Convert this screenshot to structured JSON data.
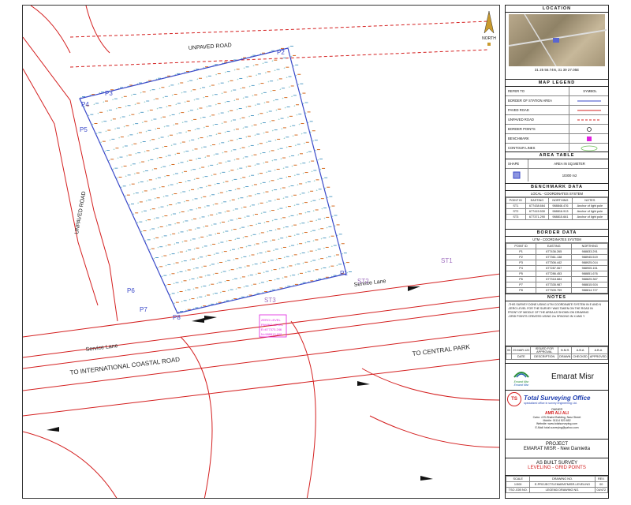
{
  "north_label": "NORTH",
  "location": {
    "title": "LOCATION",
    "coords": "31 25 56.74N, 31 39 27.05E"
  },
  "map_legend": {
    "title": "MAP LEGEND",
    "col_refer": "REFER TO",
    "col_symbol": "SYMBOL",
    "items": [
      {
        "label": "BORDER OF STATION AREA",
        "color": "#3a49c9"
      },
      {
        "label": "PAVED ROAD",
        "color": "#d42020"
      },
      {
        "label": "UNPAVED ROAD",
        "color": "#d42020"
      },
      {
        "label": "BORDER POINTS",
        "color": "#222222"
      },
      {
        "label": "BENCHMARK",
        "color": "#e020e0"
      },
      {
        "label": "CONTOUR LINES",
        "color": "#6fbf5a"
      }
    ]
  },
  "area_table": {
    "title": "AREA TABLE",
    "col_shape": "SHAPE",
    "col_area": "AREA IN SQ.METER",
    "value": "10300 m2"
  },
  "benchmark": {
    "title": "BENCHMARK DATA",
    "system": "LOCAL - COORDINATES SYSTEM",
    "headers": [
      "POINT ID",
      "EASTING",
      "NORTHING",
      "NOTES"
    ],
    "rows": [
      [
        "ST1",
        "677438.664",
        "988846.476",
        "Anchor of light pole"
      ],
      [
        "ST2",
        "677415.530",
        "988816.913",
        "Anchor of light pole"
      ],
      [
        "ST3",
        "677371.290",
        "988815.661",
        "Anchor of light pole"
      ]
    ]
  },
  "border": {
    "title": "BORDER DATA",
    "system": "UTM - COORDINATES SYSTEM",
    "headers": [
      "POINT ID",
      "EASTING",
      "NORTHING"
    ],
    "rows": [
      [
        "P1",
        "677436.265",
        "988833.291"
      ],
      [
        "P2",
        "677361.138",
        "988945.519"
      ],
      [
        "P3",
        "677306.442",
        "988925.014"
      ],
      [
        "P4",
        "677287.067",
        "988905.151"
      ],
      [
        "P5",
        "677286.453",
        "988851.676"
      ],
      [
        "P6",
        "677318.684",
        "988825.367"
      ],
      [
        "P7",
        "677335.987",
        "988815.924"
      ],
      [
        "P8",
        "677305.759",
        "988814.727"
      ]
    ]
  },
  "notes": {
    "title": "NOTES",
    "lines": [
      "-THIS SURVEY DONE USING UTM COORDINATE SYSTEM IN E AND N",
      "-ZERO LEVEL FOR THE SURVEY WAS TAKEN ON THE ROAD IN",
      " FRONT OF MIDDLE OF THE AREA AS SHOWN ON DRAWING",
      "-GRID POINTS CREATED USING 2m SPACING IN X AND Y"
    ]
  },
  "revisions": {
    "rows": [
      [
        "00",
        "29.MAR.122",
        "ISSUED FOR APPROVAL",
        "N.M.S",
        "A.B.A",
        "A.B.A"
      ],
      [
        "",
        "DATE",
        "DESCRIPTION",
        "DRAWN",
        "CHECKED",
        "APPROVED"
      ]
    ]
  },
  "client": {
    "logo_text_1": "Emarat Misr",
    "logo_text_2": "Emarat Misr",
    "name": "Emarat Misr"
  },
  "consultant": {
    "badge": "TS",
    "name": "Total Surveying Office",
    "sub": "specialized office in survey engineering Ltd.",
    "owner_label": "OWNER",
    "owner": "AMR ALI ALI",
    "line1": "Cairo: 4 El-Shahd Building, Nasr Street",
    "line2": "Mobile: 01114 523 652",
    "line3": "Website: www.totalsurveying.com",
    "line4": "E-Mail: total.surveying@yahoo.com"
  },
  "project": {
    "label": "PROJECT",
    "name": "EMARAT MISR - New Damietta"
  },
  "drawing_title": {
    "line1": "AS BUILT SURVEY",
    "line2": "LEVELING - GRID POINTS"
  },
  "title_block": {
    "scale_label": "SCALE",
    "scale": "1/300",
    "drawing_no_label": "DRAWING NO.",
    "drawing_no": "E-PROJECTS-EMARATMISR-LEVELING",
    "rev_label": "REV.",
    "rev": "00",
    "job_label": "TSO JOB NO.",
    "job": "04/472",
    "lsg_label": "LEGEND DRAWING NO."
  },
  "map_labels": {
    "road_top": "UNPAVED ROAD",
    "road_left": "UNPAVED ROAD",
    "service_lane_1": "Service Lane",
    "service_lane_2": "Service Lane",
    "coastal_road": "TO INTERNATIONAL COASTAL ROAD",
    "central_park": "TO CENTRAL PARK",
    "zero_level_1": "ZERO LEVEL",
    "zero_level_2": "PAVING LEVEL",
    "zero_level_3": "E=677373.246",
    "zero_level_4": "N=988813.608",
    "points": [
      "P1",
      "P2",
      "P3",
      "P4",
      "P5",
      "P6",
      "P7",
      "P8"
    ],
    "stations": [
      "ST1",
      "ST2",
      "ST3"
    ]
  }
}
